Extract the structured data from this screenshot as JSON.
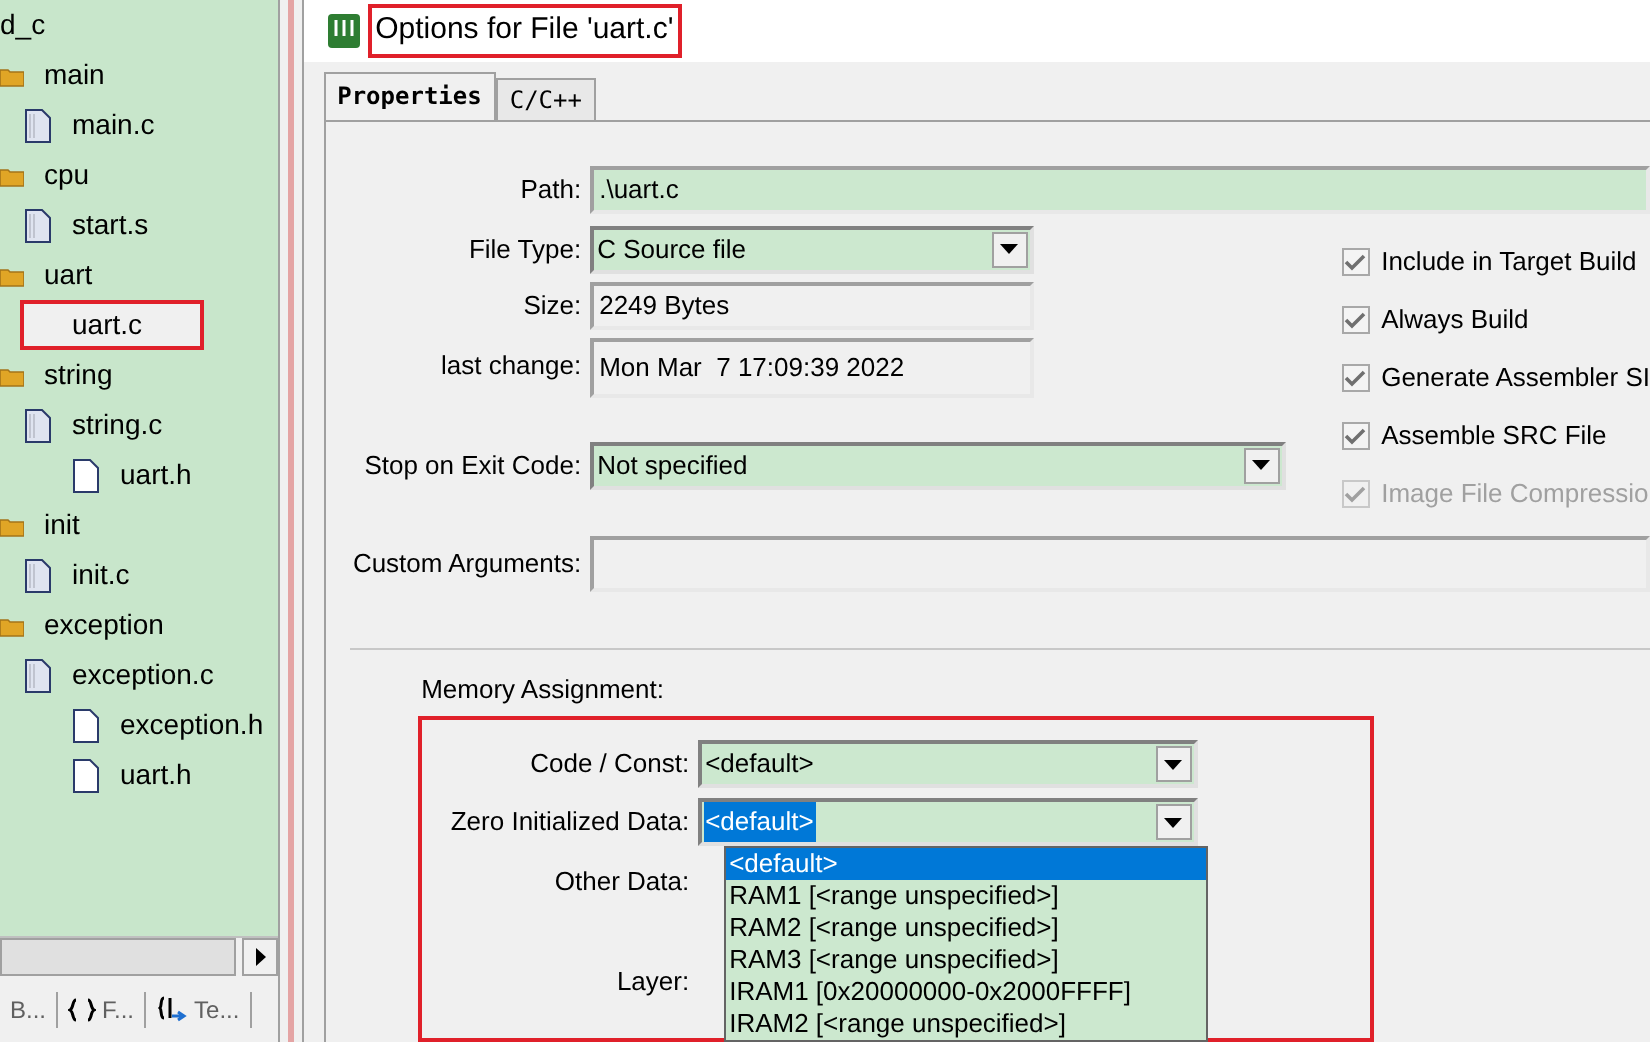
{
  "project_tree": {
    "root": "d_c",
    "children": [
      {
        "label": "main",
        "kind": "folder",
        "selected": false,
        "children": [
          {
            "label": "main.c",
            "kind": "source",
            "selected": false
          }
        ]
      },
      {
        "label": "cpu",
        "kind": "folder",
        "selected": false,
        "children": [
          {
            "label": "start.s",
            "kind": "source",
            "selected": false
          }
        ]
      },
      {
        "label": "uart",
        "kind": "folder",
        "selected": false,
        "children": [
          {
            "label": "uart.c",
            "kind": "source",
            "selected": true
          }
        ]
      },
      {
        "label": "string",
        "kind": "folder",
        "selected": false,
        "children": [
          {
            "label": "string.c",
            "kind": "source",
            "selected": false,
            "children": [
              {
                "label": "uart.h",
                "kind": "header",
                "selected": false
              }
            ]
          }
        ]
      },
      {
        "label": "init",
        "kind": "folder",
        "selected": false,
        "children": [
          {
            "label": "init.c",
            "kind": "source",
            "selected": false
          }
        ]
      },
      {
        "label": "exception",
        "kind": "folder",
        "selected": false,
        "children": [
          {
            "label": "exception.c",
            "kind": "source",
            "selected": false,
            "children": [
              {
                "label": "exception.h",
                "kind": "header",
                "selected": false
              },
              {
                "label": "uart.h",
                "kind": "header",
                "selected": false
              }
            ]
          }
        ]
      }
    ]
  },
  "panel_tabs": [
    {
      "label": "B...",
      "kind": "books"
    },
    {
      "label": "F...",
      "kind": "functions"
    },
    {
      "label": "Te...",
      "kind": "templates"
    }
  ],
  "dialog": {
    "title": "Options for File 'uart.c'",
    "tabs": [
      {
        "label": "Properties",
        "selected": true
      },
      {
        "label": "C/C++",
        "selected": false
      }
    ],
    "path": {
      "label": "Path:",
      "value": ".\\uart.c"
    },
    "file_type": {
      "label": "File Type:",
      "value": "C Source file"
    },
    "size": {
      "label": "Size:",
      "value": "2249 Bytes"
    },
    "last_change": {
      "label": "last change:",
      "value": "Mon Mar  7 17:09:39 2022"
    },
    "stop_on_exit_code": {
      "label": "Stop on Exit Code:",
      "value": "Not specified"
    },
    "custom_arguments": {
      "label": "Custom Arguments:"
    },
    "options": [
      {
        "label": "Include in Target Build",
        "checked": true,
        "disabled": false
      },
      {
        "label": "Always Build",
        "checked": true,
        "disabled": false
      },
      {
        "label": "Generate Assembler SI",
        "checked": true,
        "disabled": false
      },
      {
        "label": "Assemble SRC File",
        "checked": true,
        "disabled": false
      },
      {
        "label": "Image File Compressio",
        "checked": true,
        "disabled": true
      }
    ],
    "memory_assignment": {
      "label": "Memory Assignment:",
      "code_const": {
        "label": "Code / Const:",
        "value": "<default>",
        "focused": false
      },
      "zero_initialized_data": {
        "label": "Zero Initialized Data:",
        "value": "<default>",
        "focused": true
      },
      "other_data": {
        "label": "Other Data:"
      },
      "layer": {
        "label": "Layer:"
      },
      "dropdown_options": [
        {
          "label": "<default>",
          "selected": true
        },
        {
          "label": "RAM1 [<range unspecified>]",
          "selected": false
        },
        {
          "label": "RAM2 [<range unspecified>]",
          "selected": false
        },
        {
          "label": "RAM3 [<range unspecified>]",
          "selected": false
        },
        {
          "label": "IRAM1 [0x20000000-0x2000FFFF]",
          "selected": false
        },
        {
          "label": "IRAM2 [<range unspecified>]",
          "selected": false
        }
      ]
    }
  }
}
